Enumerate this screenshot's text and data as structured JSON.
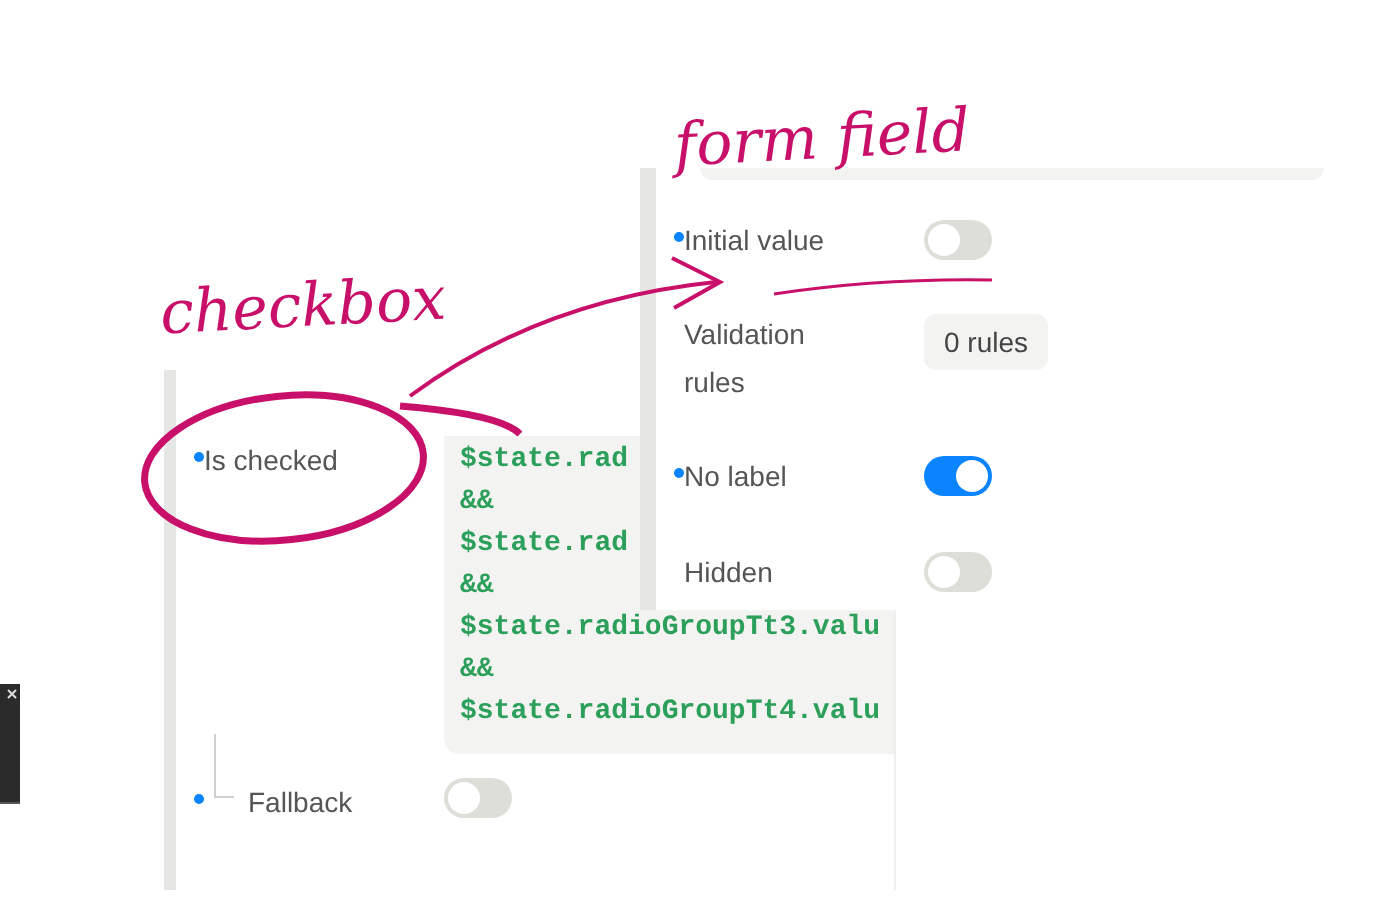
{
  "left_panel": {
    "rows": [
      {
        "kind": "code",
        "label": "Is checked",
        "dot": true,
        "code_lines": [
          "$state.rad",
          "&&",
          "$state.rad",
          "&&",
          "$state.radioGroupTt3.valu",
          "&&",
          "$state.radioGroupTt4.valu"
        ]
      },
      {
        "kind": "toggle",
        "label": "Fallback",
        "dot": true,
        "nested": true,
        "on": false
      }
    ]
  },
  "right_panel": {
    "rows": [
      {
        "kind": "toggle",
        "label": "Initial value",
        "dot": true,
        "on": false
      },
      {
        "kind": "chip",
        "label": "Validation rules",
        "dot": false,
        "value": "0 rules"
      },
      {
        "kind": "toggle",
        "label": "No label",
        "dot": true,
        "on": true
      },
      {
        "kind": "toggle",
        "label": "Hidden",
        "dot": false,
        "on": false
      }
    ]
  },
  "annotations": [
    {
      "text": "checkbox"
    },
    {
      "text": "form field"
    }
  ]
}
